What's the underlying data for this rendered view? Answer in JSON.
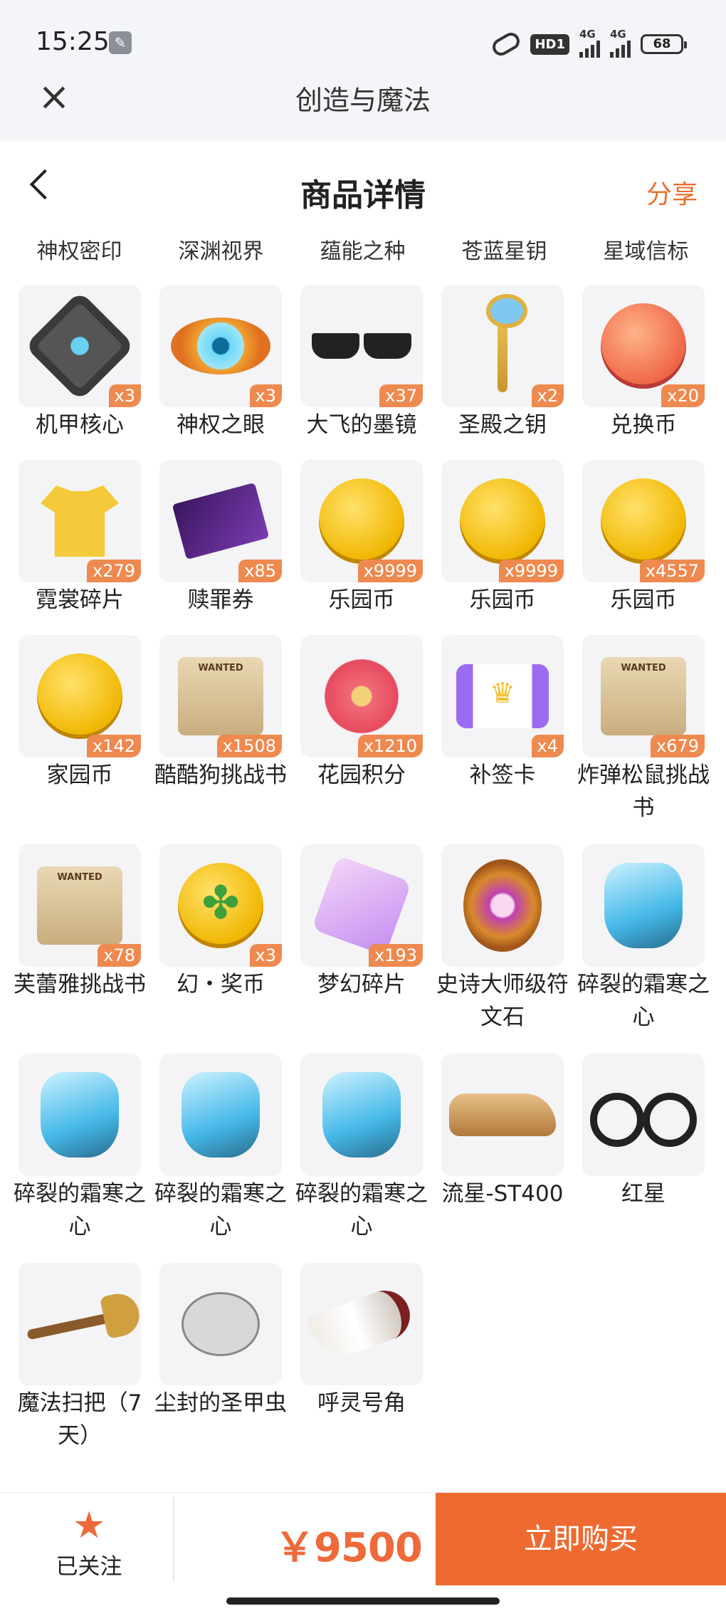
{
  "status_bar": {
    "time": "15:25",
    "hd_label": "HD1",
    "net1": "4G",
    "net2": "4G",
    "battery": "68"
  },
  "app_bar": {
    "title": "创造与魔法"
  },
  "page": {
    "title": "商品详情",
    "share_label": "分享"
  },
  "name_row": [
    "神权密印",
    "深渊视界",
    "蕴能之种",
    "苍蓝星钥",
    "星域信标"
  ],
  "items": [
    {
      "name": "机甲核心",
      "count": "x3",
      "icon": "shape-cube"
    },
    {
      "name": "神权之眼",
      "count": "x3",
      "icon": "shape-eye"
    },
    {
      "name": "大飞的墨镜",
      "count": "x37",
      "icon": "shape-glasses"
    },
    {
      "name": "圣殿之钥",
      "count": "x2",
      "icon": "shape-key"
    },
    {
      "name": "兑换币",
      "count": "x20",
      "icon": "coin red"
    },
    {
      "name": "霓裳碎片",
      "count": "x279",
      "icon": "shape-shirt"
    },
    {
      "name": "赎罪券",
      "count": "x85",
      "icon": "shape-ticket"
    },
    {
      "name": "乐园币",
      "count": "x9999",
      "icon": "coin"
    },
    {
      "name": "乐园币",
      "count": "x9999",
      "icon": "coin"
    },
    {
      "name": "乐园币",
      "count": "x4557",
      "icon": "coin"
    },
    {
      "name": "家园币",
      "count": "x142",
      "icon": "coin"
    },
    {
      "name": "酷酷狗挑战书",
      "count": "x1508",
      "icon": "shape-scroll"
    },
    {
      "name": "花园积分",
      "count": "x1210",
      "icon": "shape-flower"
    },
    {
      "name": "补签卡",
      "count": "x4",
      "icon": "shape-card"
    },
    {
      "name": "炸弹松鼠挑战书",
      "count": "x679",
      "icon": "shape-scroll"
    },
    {
      "name": "芙蕾雅挑战书",
      "count": "x78",
      "icon": "shape-scroll"
    },
    {
      "name": "幻・奖币",
      "count": "x3",
      "icon": "coin green-center"
    },
    {
      "name": "梦幻碎片",
      "count": "x193",
      "icon": "shape-puzzle"
    },
    {
      "name": "史诗大师级符文石",
      "count": "",
      "icon": "shape-rune"
    },
    {
      "name": "碎裂的霜寒之心",
      "count": "",
      "icon": "shape-ice"
    },
    {
      "name": "碎裂的霜寒之心",
      "count": "",
      "icon": "shape-ice"
    },
    {
      "name": "碎裂的霜寒之心",
      "count": "",
      "icon": "shape-ice"
    },
    {
      "name": "碎裂的霜寒之心",
      "count": "",
      "icon": "shape-ice"
    },
    {
      "name": "流星-ST400",
      "count": "",
      "icon": "shape-vehicle"
    },
    {
      "name": "红星",
      "count": "",
      "icon": "shape-moto"
    },
    {
      "name": "魔法扫把（7天）",
      "count": "",
      "icon": "shape-broom"
    },
    {
      "name": "尘封的圣甲虫",
      "count": "",
      "icon": "shape-beetle"
    },
    {
      "name": "呼灵号角",
      "count": "",
      "icon": "shape-horn"
    }
  ],
  "bottom": {
    "follow_label": "已关注",
    "price": "￥9500",
    "buy_label": "立即购买"
  },
  "colors": {
    "accent": "#ee6a30",
    "badge": "#ee8a4f"
  }
}
